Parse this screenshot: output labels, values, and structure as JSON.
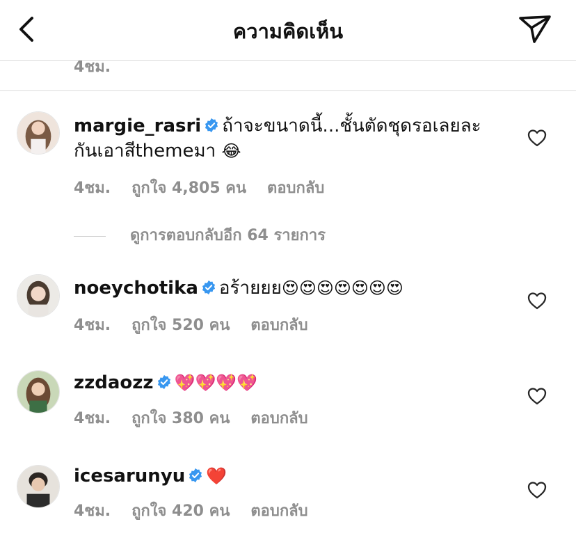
{
  "header": {
    "title": "ความคิดเห็น"
  },
  "cutoff_time": "4ชม.",
  "view_more": "ดูการตอบกลับอีก 64 รายการ",
  "comments": [
    {
      "username": "margie_rasri",
      "text_line1": "ถ้าจะขนาดนี้...ชั้นตัดชุดรอเลยละ",
      "text_line2": "กันเอาสีthemeมา",
      "emoji": "😂",
      "time": "4ชม.",
      "likes": "ถูกใจ 4,805 คน",
      "reply": "ตอบกลับ"
    },
    {
      "username": "noeychotika",
      "text": "อร้ายยย",
      "emoji": "😍😍😍😍😍😍😍",
      "time": "4ชม.",
      "likes": "ถูกใจ 520 คน",
      "reply": "ตอบกลับ"
    },
    {
      "username": "zzdaozz",
      "text": "",
      "emoji": "💖💖💖💖",
      "time": "4ชม.",
      "likes": "ถูกใจ 380 คน",
      "reply": "ตอบกลับ"
    },
    {
      "username": "icesarunyu",
      "text": "",
      "emoji": "❤️",
      "time": "4ชม.",
      "likes": "ถูกใจ 420 คน",
      "reply": "ตอบกลับ"
    }
  ],
  "colors": {
    "verified": "#3897f0",
    "meta": "#8e8e8e",
    "text": "#262626"
  }
}
